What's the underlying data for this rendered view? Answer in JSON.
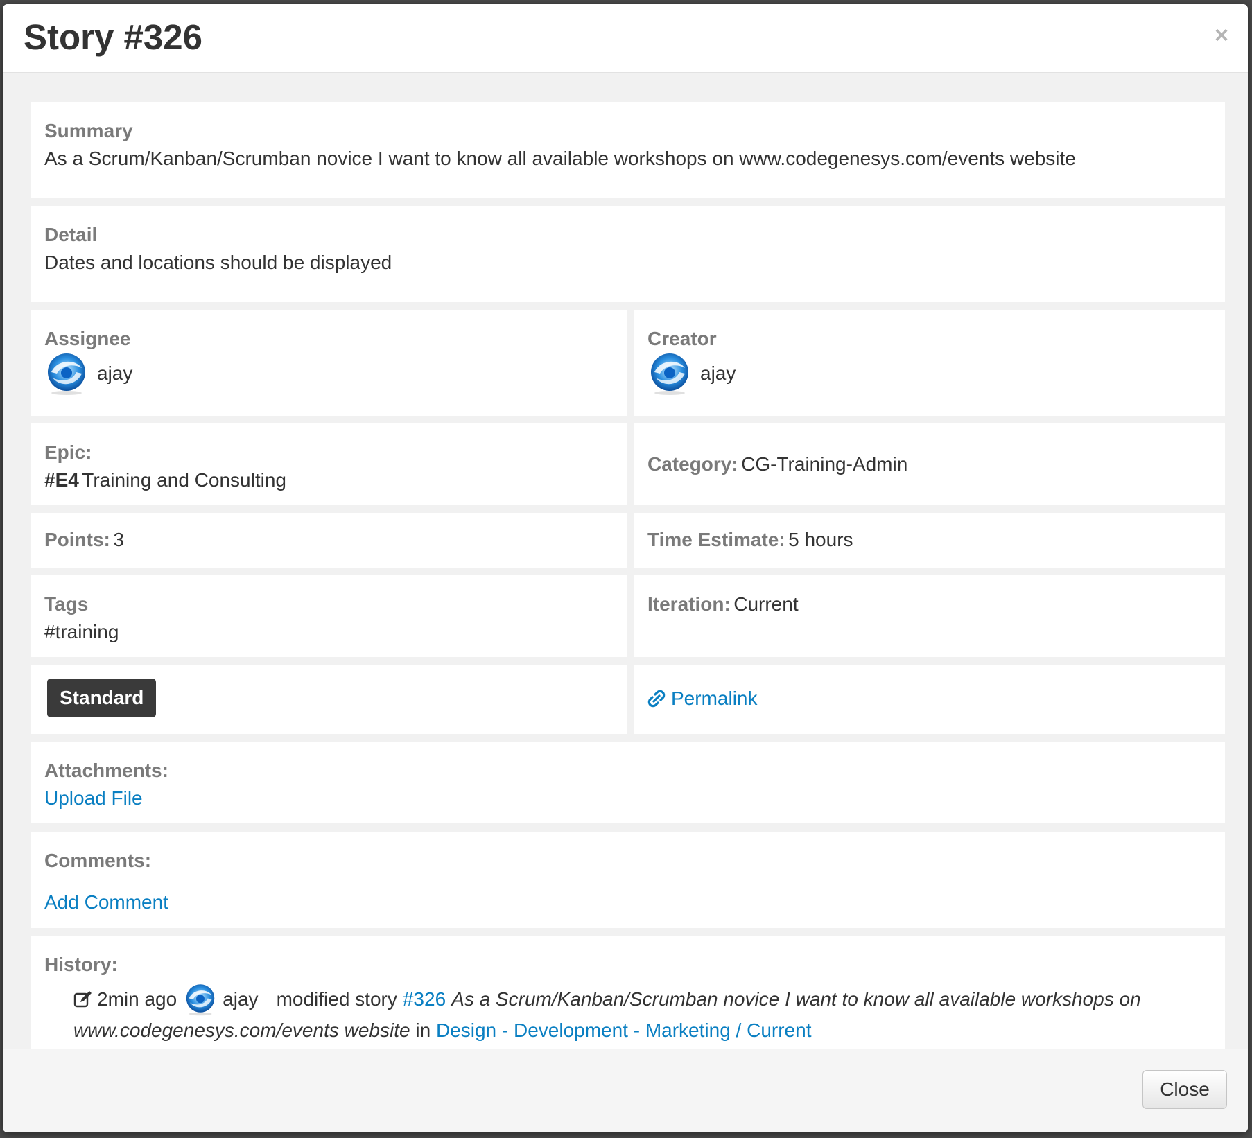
{
  "modal": {
    "title": "Story #326",
    "close_symbol": "×"
  },
  "summary": {
    "label": "Summary",
    "text": "As a Scrum/Kanban/Scrumban novice I want to know all available workshops on www.codegenesys.com/events website"
  },
  "detail": {
    "label": "Detail",
    "text": "Dates and locations should be displayed"
  },
  "assignee": {
    "label": "Assignee",
    "name": "ajay"
  },
  "creator": {
    "label": "Creator",
    "name": "ajay"
  },
  "epic": {
    "label": "Epic:",
    "id": "#E4",
    "name": "Training and Consulting"
  },
  "category": {
    "label": "Category:",
    "value": "CG-Training-Admin"
  },
  "points": {
    "label": "Points:",
    "value": "3"
  },
  "time_estimate": {
    "label": "Time Estimate:",
    "value": "5 hours"
  },
  "tags": {
    "label": "Tags",
    "value": "#training"
  },
  "iteration": {
    "label": "Iteration:",
    "value": "Current"
  },
  "story_type": {
    "badge": "Standard"
  },
  "permalink": {
    "label": "Permalink"
  },
  "attachments": {
    "label": "Attachments:",
    "upload_link": "Upload File"
  },
  "comments": {
    "label": "Comments:",
    "add_link": "Add Comment"
  },
  "history": {
    "label": "History:",
    "entries": [
      {
        "time": "2min ago",
        "user": "ajay",
        "action": "modified story",
        "story_link": "#326",
        "story_text_1": "As a Scrum/Kanban/Scrumban novice I want to know all available workshops on",
        "story_text_2": "www.codegenesys.com/events website",
        "in_word": "in",
        "location_link": "Design - Development - Marketing / Current"
      }
    ]
  },
  "footer": {
    "close_label": "Close"
  },
  "colors": {
    "link": "#0a7fc2",
    "label": "#7a7a7a",
    "body_bg": "#f1f1f1",
    "badge_bg": "#3a3a3a"
  },
  "icons": {
    "avatar": "user-avatar-icon",
    "permalink": "link-icon",
    "history_edit": "edit-icon"
  }
}
